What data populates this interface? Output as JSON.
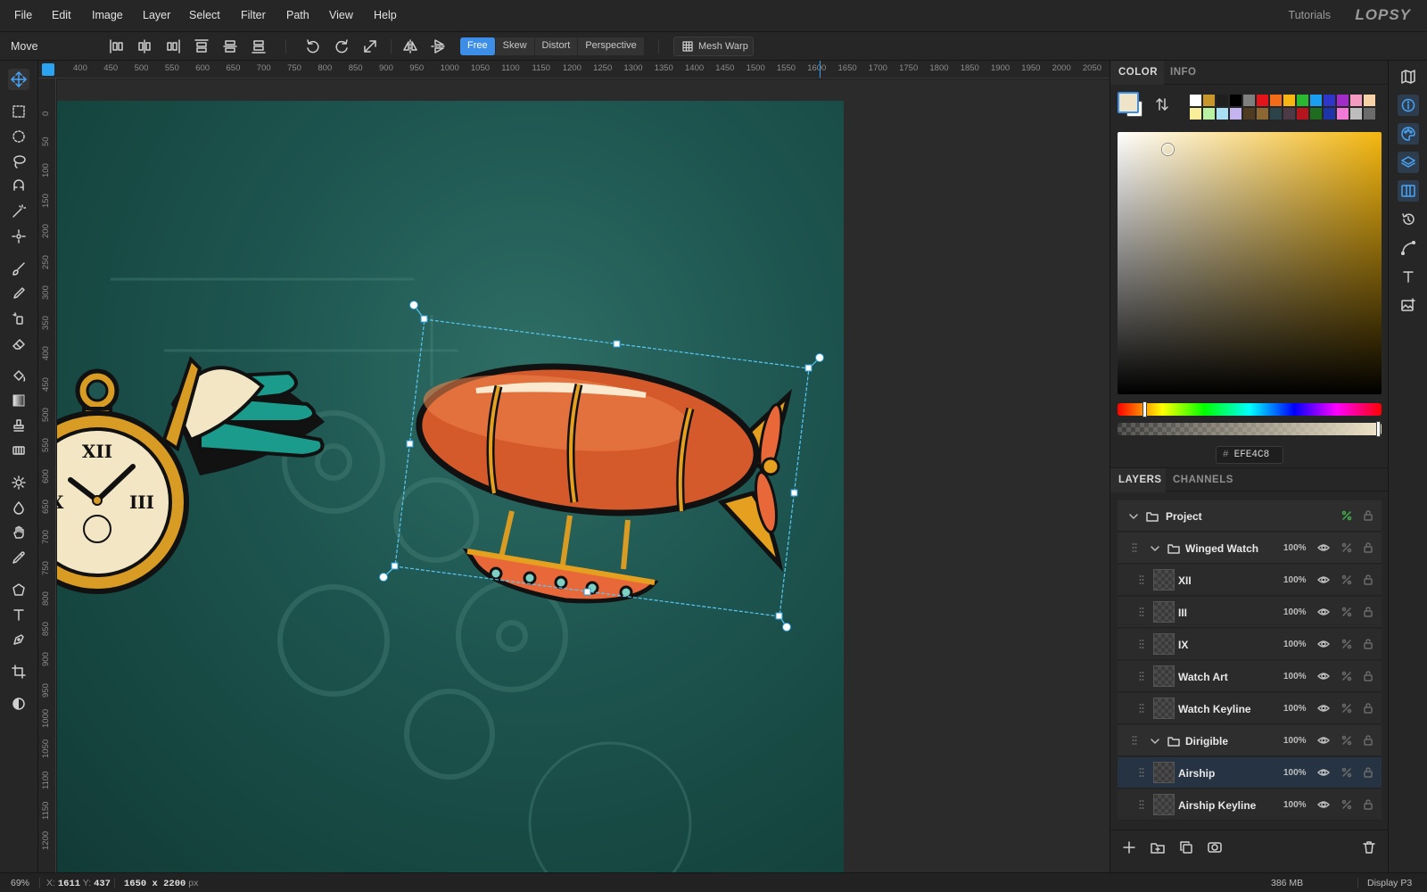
{
  "menu": [
    "File",
    "Edit",
    "Image",
    "Layer",
    "Select",
    "Filter",
    "Path",
    "View",
    "Help"
  ],
  "tutorials_label": "Tutorials",
  "logo_text": "LOPSY",
  "options": {
    "tool_name": "Move",
    "modes": [
      "Free",
      "Skew",
      "Distort",
      "Perspective"
    ],
    "active_mode": "Free",
    "mesh_warp_label": "Mesh Warp"
  },
  "ruler": {
    "top": [
      "400",
      "450",
      "500",
      "550",
      "600",
      "650",
      "700",
      "750",
      "800",
      "850",
      "900",
      "950",
      "1000",
      "1050",
      "1100",
      "1150",
      "1200",
      "1250",
      "1300",
      "1350",
      "1400",
      "1450",
      "1500",
      "1550",
      "1600",
      "1650",
      "1700",
      "1750",
      "1800",
      "1850",
      "1900",
      "1950",
      "2000",
      "2050"
    ],
    "left": [
      "0",
      "50",
      "100",
      "150",
      "200",
      "250",
      "300",
      "350",
      "400",
      "450",
      "500",
      "550",
      "600",
      "650",
      "700",
      "750",
      "800",
      "850",
      "900",
      "950",
      "1000",
      "1050",
      "1100",
      "1150",
      "1200"
    ]
  },
  "canvas_art": {
    "numeral_top": "XII",
    "numeral_right": "III",
    "numeral_left": "IX"
  },
  "color_panel": {
    "tabs": [
      "COLOR",
      "INFO"
    ],
    "active_tab": "COLOR",
    "foreground": "#efe4c8",
    "background": "#ffffff",
    "hex_value": "EFE4C8",
    "hex_prefix": "#",
    "swatches": [
      "#ffffff",
      "#c9962c",
      "#1f1f1f",
      "#000000",
      "#7f7f7f",
      "#e4141b",
      "#f26c1a",
      "#f7b612",
      "#2ab830",
      "#1b9ef0",
      "#2e35c9",
      "#a12cc7",
      "#f59ac0",
      "#f7d2a7",
      "#f9ef9a",
      "#b9f2a2",
      "#a9dff4",
      "#c5b3f0",
      "#4e3b22",
      "#8a6733",
      "#2c4449",
      "#4c3b47",
      "#b5151d",
      "#1f6b20",
      "#1d35a6",
      "#f07ad6",
      "#bdbdbd",
      "#6b6b6b"
    ]
  },
  "layers_panel": {
    "tabs": [
      "LAYERS",
      "CHANNELS"
    ],
    "active_tab": "LAYERS",
    "layers": [
      {
        "name": "Project",
        "type": "group",
        "depth": 0,
        "opacity": "",
        "selected": false
      },
      {
        "name": "Winged Watch",
        "type": "group",
        "depth": 1,
        "opacity": "100%",
        "selected": false
      },
      {
        "name": "XII",
        "type": "layer",
        "depth": 2,
        "opacity": "100%",
        "selected": false
      },
      {
        "name": "III",
        "type": "layer",
        "depth": 2,
        "opacity": "100%",
        "selected": false
      },
      {
        "name": "IX",
        "type": "layer",
        "depth": 2,
        "opacity": "100%",
        "selected": false
      },
      {
        "name": "Watch Art",
        "type": "layer",
        "depth": 2,
        "opacity": "100%",
        "selected": false
      },
      {
        "name": "Watch Keyline",
        "type": "layer",
        "depth": 2,
        "opacity": "100%",
        "selected": false
      },
      {
        "name": "Dirigible",
        "type": "group",
        "depth": 1,
        "opacity": "100%",
        "selected": false
      },
      {
        "name": "Airship",
        "type": "layer",
        "depth": 2,
        "opacity": "100%",
        "selected": true
      },
      {
        "name": "Airship Keyline",
        "type": "layer",
        "depth": 2,
        "opacity": "100%",
        "selected": false
      }
    ]
  },
  "status": {
    "zoom": "69%",
    "x_label": "X:",
    "x_value": "1611",
    "y_label": "Y:",
    "y_value": "437",
    "doc_size": "1650 x 2200",
    "doc_unit": "px",
    "memory": "386 MB",
    "color_profile": "Display P3"
  }
}
